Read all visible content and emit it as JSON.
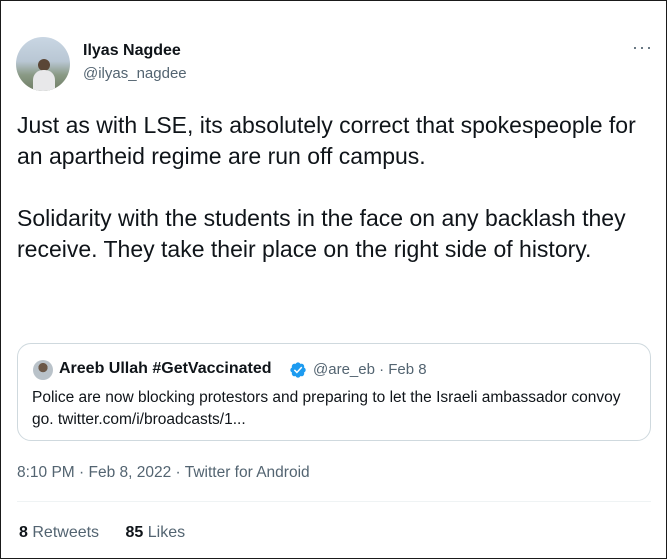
{
  "author": {
    "name": "Ilyas Nagdee",
    "handle": "@ilyas_nagdee",
    "more_icon": "more-horizontal-icon"
  },
  "tweet": {
    "paragraphs": [
      "Just as with LSE, its absolutely correct that spokespeople for an apartheid regime are run off campus.",
      "Solidarity with the students in the face on any backlash they receive. They take their place on the right side of history."
    ]
  },
  "quoted_tweet": {
    "name": "Areeb Ullah #GetVaccinated",
    "verified_icon": "verified-badge-icon",
    "meta": "@are_eb · Feb 8",
    "text": "Police are now blocking protestors and preparing to let the Israeli ambassador convoy go. twitter.com/i/broadcasts/1..."
  },
  "timestamp": "8:10 PM · Feb 8, 2022 · Twitter for Android",
  "stats": {
    "retweets_count": "8",
    "retweets_label": "Retweets",
    "likes_count": "85",
    "likes_label": "Likes"
  },
  "colors": {
    "text": "#0f1419",
    "secondary": "#536471",
    "verified": "#1d9bf0",
    "border": "#cfd9de"
  }
}
